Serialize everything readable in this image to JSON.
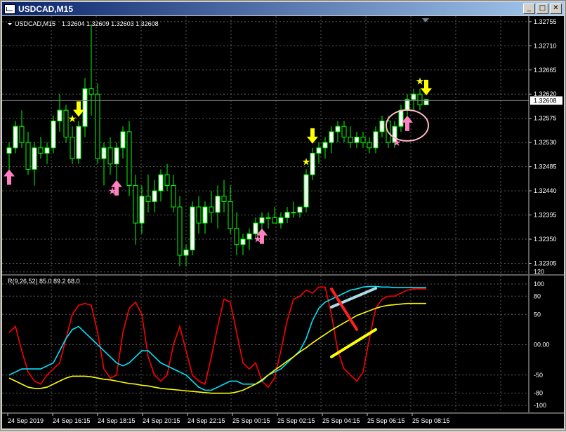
{
  "window": {
    "title": "USDCAD,M15",
    "buttons": {
      "minimize": "_",
      "maximize": "□",
      "close": "✕"
    }
  },
  "chart_data": [
    {
      "type": "candlestick",
      "symbol_label": "USDCAD,M15",
      "ohlc_label": "1.32604 1.32609 1.32603 1.32608",
      "current_price": "1.32608",
      "price_ticks": [
        "1.32755",
        "1.32710",
        "1.32665",
        "1.32620",
        "1.32575",
        "1.32530",
        "1.32485",
        "1.32440",
        "1.32395",
        "1.32350",
        "1.32305"
      ],
      "ylim": [
        1.3229,
        1.3276
      ],
      "time_ticks": [
        "24 Sep 2019",
        "24 Sep 16:15",
        "24 Sep 18:15",
        "24 Sep 20:15",
        "24 Sep 22:15",
        "25 Sep 00:15",
        "25 Sep 02:15",
        "25 Sep 04:15",
        "25 Sep 06:15",
        "25 Sep 08:15"
      ],
      "grid": true,
      "colors": {
        "up": "#ffffff",
        "down": "#000000",
        "wick": "#00ff00",
        "grid": "#5a5a5a"
      },
      "candles": [
        [
          1.3251,
          1.3253,
          1.3248,
          1.3252
        ],
        [
          1.3252,
          1.3257,
          1.3251,
          1.3256
        ],
        [
          1.3256,
          1.3259,
          1.3252,
          1.3253
        ],
        [
          1.3253,
          1.3255,
          1.3247,
          1.3248
        ],
        [
          1.3248,
          1.3253,
          1.3245,
          1.3252
        ],
        [
          1.3252,
          1.3254,
          1.325,
          1.3251
        ],
        [
          1.3251,
          1.3253,
          1.3249,
          1.3252
        ],
        [
          1.3252,
          1.3258,
          1.3251,
          1.3257
        ],
        [
          1.3257,
          1.3262,
          1.3255,
          1.3259
        ],
        [
          1.3259,
          1.326,
          1.3253,
          1.3254
        ],
        [
          1.3254,
          1.3256,
          1.3249,
          1.325
        ],
        [
          1.325,
          1.3257,
          1.3249,
          1.3256
        ],
        [
          1.3256,
          1.3265,
          1.3254,
          1.3263
        ],
        [
          1.3263,
          1.3275,
          1.3258,
          1.3262
        ],
        [
          1.3262,
          1.3264,
          1.3249,
          1.325
        ],
        [
          1.325,
          1.3253,
          1.3245,
          1.3252
        ],
        [
          1.3252,
          1.3254,
          1.3247,
          1.3249
        ],
        [
          1.3249,
          1.3253,
          1.3246,
          1.3252
        ],
        [
          1.3252,
          1.3256,
          1.325,
          1.3255
        ],
        [
          1.3255,
          1.3257,
          1.3243,
          1.3245
        ],
        [
          1.3245,
          1.3247,
          1.3234,
          1.3238
        ],
        [
          1.3238,
          1.3245,
          1.3236,
          1.3243
        ],
        [
          1.3243,
          1.3247,
          1.324,
          1.3242
        ],
        [
          1.3242,
          1.3246,
          1.324,
          1.3244
        ],
        [
          1.3244,
          1.3248,
          1.3242,
          1.3247
        ],
        [
          1.3247,
          1.3249,
          1.3244,
          1.3245
        ],
        [
          1.3245,
          1.3247,
          1.324,
          1.3241
        ],
        [
          1.3241,
          1.3243,
          1.323,
          1.3232
        ],
        [
          1.3232,
          1.3234,
          1.323,
          1.3233
        ],
        [
          1.3233,
          1.3242,
          1.3232,
          1.3241
        ],
        [
          1.3241,
          1.3243,
          1.3236,
          1.3238
        ],
        [
          1.3238,
          1.3242,
          1.3236,
          1.3241
        ],
        [
          1.3241,
          1.3244,
          1.3238,
          1.324
        ],
        [
          1.324,
          1.3245,
          1.3237,
          1.3243
        ],
        [
          1.3243,
          1.3246,
          1.324,
          1.3242
        ],
        [
          1.3242,
          1.3245,
          1.3236,
          1.3237
        ],
        [
          1.3237,
          1.324,
          1.3232,
          1.3234
        ],
        [
          1.3234,
          1.3236,
          1.3232,
          1.3235
        ],
        [
          1.3235,
          1.3237,
          1.3233,
          1.3236
        ],
        [
          1.3236,
          1.3239,
          1.3235,
          1.3238
        ],
        [
          1.3238,
          1.324,
          1.3237,
          1.3239
        ],
        [
          1.3239,
          1.324,
          1.3237,
          1.3239
        ],
        [
          1.3239,
          1.3241,
          1.3238,
          1.3238
        ],
        [
          1.3238,
          1.324,
          1.3237,
          1.3239
        ],
        [
          1.3239,
          1.3241,
          1.3238,
          1.324
        ],
        [
          1.324,
          1.3242,
          1.3239,
          1.324
        ],
        [
          1.324,
          1.3241,
          1.3239,
          1.3241
        ],
        [
          1.3241,
          1.3248,
          1.324,
          1.3247
        ],
        [
          1.3247,
          1.3252,
          1.3246,
          1.3251
        ],
        [
          1.3251,
          1.3253,
          1.3249,
          1.3252
        ],
        [
          1.3252,
          1.3254,
          1.325,
          1.3253
        ],
        [
          1.3253,
          1.3256,
          1.3251,
          1.3255
        ],
        [
          1.3255,
          1.3257,
          1.3253,
          1.3256
        ],
        [
          1.3256,
          1.3257,
          1.3253,
          1.3254
        ],
        [
          1.3254,
          1.3256,
          1.3252,
          1.3253
        ],
        [
          1.3253,
          1.3255,
          1.3252,
          1.3254
        ],
        [
          1.3254,
          1.3255,
          1.3252,
          1.3253
        ],
        [
          1.3253,
          1.3254,
          1.3251,
          1.3252
        ],
        [
          1.3252,
          1.3256,
          1.3251,
          1.3255
        ],
        [
          1.3255,
          1.3258,
          1.3254,
          1.3257
        ],
        [
          1.3257,
          1.3258,
          1.3252,
          1.3253
        ],
        [
          1.3253,
          1.3257,
          1.3252,
          1.3256
        ],
        [
          1.3256,
          1.326,
          1.3255,
          1.3259
        ],
        [
          1.3259,
          1.3262,
          1.3258,
          1.3261
        ],
        [
          1.3261,
          1.3263,
          1.3259,
          1.3262
        ],
        [
          1.3262,
          1.3263,
          1.3259,
          1.326
        ],
        [
          1.326,
          1.3261,
          1.326,
          1.3261
        ]
      ],
      "signals": {
        "pink_up_arrows": [
          0,
          17,
          40,
          63
        ],
        "pink_stars": [
          17,
          40,
          62
        ],
        "yellow_down_arrows": [
          11,
          48,
          66
        ],
        "yellow_stars": [
          10,
          47,
          65
        ]
      }
    },
    {
      "type": "line",
      "label": "R(9,26,52) 85.0 89.2 68.0",
      "ylim": [
        -100,
        100
      ],
      "y_ticks": [
        "120",
        "100",
        "80",
        "50",
        "00.00",
        "-50",
        "-80",
        "-100"
      ],
      "series": [
        {
          "color": "#ff0000",
          "values": [
            20,
            30,
            -10,
            -45,
            -60,
            -65,
            -50,
            -40,
            -30,
            10,
            50,
            65,
            68,
            65,
            20,
            -40,
            -55,
            -50,
            20,
            60,
            70,
            50,
            -20,
            -50,
            -60,
            -50,
            0,
            30,
            -10,
            -50,
            -60,
            -65,
            -20,
            30,
            75,
            70,
            20,
            -30,
            -40,
            -30,
            -60,
            -70,
            -55,
            -10,
            40,
            75,
            80,
            90,
            85,
            95,
            95,
            50,
            -10,
            -40,
            -50,
            -60,
            -45,
            10,
            60,
            75,
            80,
            80,
            85,
            90,
            92,
            92,
            92
          ]
        },
        {
          "color": "#00e5ff",
          "values": [
            -50,
            -45,
            -40,
            -40,
            -40,
            -40,
            -35,
            -30,
            -10,
            10,
            25,
            30,
            20,
            10,
            0,
            -10,
            -20,
            -30,
            -35,
            -30,
            -20,
            -10,
            -10,
            -20,
            -30,
            -35,
            -40,
            -45,
            -50,
            -60,
            -70,
            -75,
            -75,
            -70,
            -65,
            -60,
            -60,
            -65,
            -65,
            -65,
            -60,
            -50,
            -45,
            -40,
            -30,
            -20,
            -10,
            10,
            40,
            60,
            70,
            75,
            80,
            85,
            90,
            92,
            95,
            96,
            96,
            95,
            95,
            94,
            94,
            94,
            94,
            94,
            94
          ]
        },
        {
          "color": "#ffff00",
          "values": [
            -55,
            -60,
            -65,
            -70,
            -72,
            -72,
            -70,
            -65,
            -60,
            -55,
            -52,
            -52,
            -52,
            -53,
            -55,
            -57,
            -58,
            -60,
            -62,
            -64,
            -65,
            -67,
            -68,
            -70,
            -72,
            -73,
            -74,
            -75,
            -76,
            -77,
            -78,
            -79,
            -80,
            -80,
            -80,
            -80,
            -78,
            -75,
            -70,
            -65,
            -58,
            -50,
            -42,
            -35,
            -27,
            -20,
            -12,
            -5,
            3,
            10,
            17,
            24,
            30,
            36,
            42,
            48,
            52,
            56,
            60,
            63,
            65,
            66,
            67,
            68,
            68,
            68,
            68
          ]
        }
      ],
      "annotations": [
        {
          "kind": "trendline",
          "color": "#add8e6"
        },
        {
          "kind": "trendline",
          "color": "#ff2020"
        },
        {
          "kind": "trendline",
          "color": "#ffff00"
        }
      ]
    }
  ]
}
